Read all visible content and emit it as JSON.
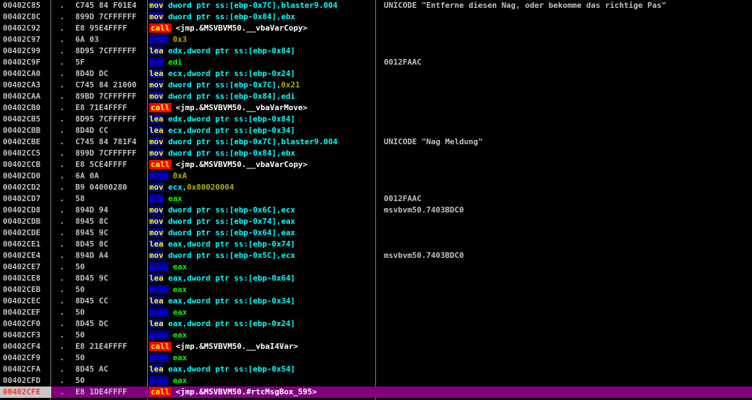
{
  "rows": [
    {
      "addr": "00402C85",
      "mark": ".",
      "hex": "C745 84 F01E4",
      "mn": "mov",
      "ops": "dword ptr ss:[ebp-0x7C],blaster9.004",
      "comment": "UNICODE \"Entferne diesen Nag, oder bekomme das richtige Pas\""
    },
    {
      "addr": "00402C8C",
      "mark": ".",
      "hex": "899D 7CFFFFFF",
      "mn": "mov",
      "ops": "dword ptr ss:[ebp-0x84],ebx",
      "comment": ""
    },
    {
      "addr": "00402C92",
      "mark": ".",
      "hex": "E8 95E4FFFF",
      "mn": "call",
      "ops": "<jmp.&MSVBVM50.__vbaVarCopy>",
      "comment": ""
    },
    {
      "addr": "00402C97",
      "mark": ".",
      "hex": "6A 03",
      "mn": "push",
      "ops": "0x3",
      "comment": ""
    },
    {
      "addr": "00402C99",
      "mark": ".",
      "hex": "8D95 7CFFFFFF",
      "mn": "lea",
      "ops": "edx,dword ptr ss:[ebp-0x84]",
      "comment": ""
    },
    {
      "addr": "00402C9F",
      "mark": ".",
      "hex": "5F",
      "mn": "pop",
      "ops": "edi",
      "comment": "0012FAAC"
    },
    {
      "addr": "00402CA0",
      "mark": ".",
      "hex": "8D4D DC",
      "mn": "lea",
      "ops": "ecx,dword ptr ss:[ebp-0x24]",
      "comment": ""
    },
    {
      "addr": "00402CA3",
      "mark": ".",
      "hex": "C745 84 21000",
      "mn": "mov",
      "ops": "dword ptr ss:[ebp-0x7C],0x21",
      "comment": ""
    },
    {
      "addr": "00402CAA",
      "mark": ".",
      "hex": "89BD 7CFFFFFF",
      "mn": "mov",
      "ops": "dword ptr ss:[ebp-0x84],edi",
      "comment": ""
    },
    {
      "addr": "00402CB0",
      "mark": ".",
      "hex": "E8 71E4FFFF",
      "mn": "call",
      "ops": "<jmp.&MSVBVM50.__vbaVarMove>",
      "comment": ""
    },
    {
      "addr": "00402CB5",
      "mark": ".",
      "hex": "8D95 7CFFFFFF",
      "mn": "lea",
      "ops": "edx,dword ptr ss:[ebp-0x84]",
      "comment": ""
    },
    {
      "addr": "00402CBB",
      "mark": ".",
      "hex": "8D4D CC",
      "mn": "lea",
      "ops": "ecx,dword ptr ss:[ebp-0x34]",
      "comment": ""
    },
    {
      "addr": "00402CBE",
      "mark": ".",
      "hex": "C745 84 781F4",
      "mn": "mov",
      "ops": "dword ptr ss:[ebp-0x7C],blaster9.004",
      "comment": "UNICODE \"Nag Meldung\""
    },
    {
      "addr": "00402CC5",
      "mark": ".",
      "hex": "899D 7CFFFFFF",
      "mn": "mov",
      "ops": "dword ptr ss:[ebp-0x84],ebx",
      "comment": ""
    },
    {
      "addr": "00402CCB",
      "mark": ".",
      "hex": "E8 5CE4FFFF",
      "mn": "call",
      "ops": "<jmp.&MSVBVM50.__vbaVarCopy>",
      "comment": ""
    },
    {
      "addr": "00402CD0",
      "mark": ".",
      "hex": "6A 0A",
      "mn": "push",
      "ops": "0xA",
      "comment": ""
    },
    {
      "addr": "00402CD2",
      "mark": ".",
      "hex": "B9 04000280",
      "mn": "mov",
      "ops": "ecx,0x80020004",
      "comment": ""
    },
    {
      "addr": "00402CD7",
      "mark": ".",
      "hex": "58",
      "mn": "pop",
      "ops": "eax",
      "comment": "0012FAAC"
    },
    {
      "addr": "00402CD8",
      "mark": ".",
      "hex": "894D 94",
      "mn": "mov",
      "ops": "dword ptr ss:[ebp-0x6C],ecx",
      "comment": "msvbvm50.7403BDC0"
    },
    {
      "addr": "00402CDB",
      "mark": ".",
      "hex": "8945 8C",
      "mn": "mov",
      "ops": "dword ptr ss:[ebp-0x74],eax",
      "comment": ""
    },
    {
      "addr": "00402CDE",
      "mark": ".",
      "hex": "8945 9C",
      "mn": "mov",
      "ops": "dword ptr ss:[ebp-0x64],eax",
      "comment": ""
    },
    {
      "addr": "00402CE1",
      "mark": ".",
      "hex": "8D45 8C",
      "mn": "lea",
      "ops": "eax,dword ptr ss:[ebp-0x74]",
      "comment": ""
    },
    {
      "addr": "00402CE4",
      "mark": ".",
      "hex": "894D A4",
      "mn": "mov",
      "ops": "dword ptr ss:[ebp-0x5C],ecx",
      "comment": "msvbvm50.7403BDC0"
    },
    {
      "addr": "00402CE7",
      "mark": ".",
      "hex": "50",
      "mn": "push",
      "ops": "eax",
      "comment": ""
    },
    {
      "addr": "00402CE8",
      "mark": ".",
      "hex": "8D45 9C",
      "mn": "lea",
      "ops": "eax,dword ptr ss:[ebp-0x64]",
      "comment": ""
    },
    {
      "addr": "00402CEB",
      "mark": ".",
      "hex": "50",
      "mn": "push",
      "ops": "eax",
      "comment": ""
    },
    {
      "addr": "00402CEC",
      "mark": ".",
      "hex": "8D45 CC",
      "mn": "lea",
      "ops": "eax,dword ptr ss:[ebp-0x34]",
      "comment": ""
    },
    {
      "addr": "00402CEF",
      "mark": ".",
      "hex": "50",
      "mn": "push",
      "ops": "eax",
      "comment": ""
    },
    {
      "addr": "00402CF0",
      "mark": ".",
      "hex": "8D45 DC",
      "mn": "lea",
      "ops": "eax,dword ptr ss:[ebp-0x24]",
      "comment": ""
    },
    {
      "addr": "00402CF3",
      "mark": ".",
      "hex": "50",
      "mn": "push",
      "ops": "eax",
      "comment": ""
    },
    {
      "addr": "00402CF4",
      "mark": ".",
      "hex": "E8 21E4FFFF",
      "mn": "call",
      "ops": "<jmp.&MSVBVM50.__vbaI4Var>",
      "comment": ""
    },
    {
      "addr": "00402CF9",
      "mark": ".",
      "hex": "50",
      "mn": "push",
      "ops": "eax",
      "comment": ""
    },
    {
      "addr": "00402CFA",
      "mark": ".",
      "hex": "8D45 AC",
      "mn": "lea",
      "ops": "eax,dword ptr ss:[ebp-0x54]",
      "comment": ""
    },
    {
      "addr": "00402CFD",
      "mark": ".",
      "hex": "50",
      "mn": "push",
      "ops": "eax",
      "comment": ""
    },
    {
      "addr": "00402CFE",
      "mark": ".",
      "hex": "E8 1DE4FFFF",
      "mn": "call",
      "ops": "<jmp.&MSVBVM50.#rtcMsgBox_595>",
      "comment": "",
      "selected": true
    }
  ]
}
